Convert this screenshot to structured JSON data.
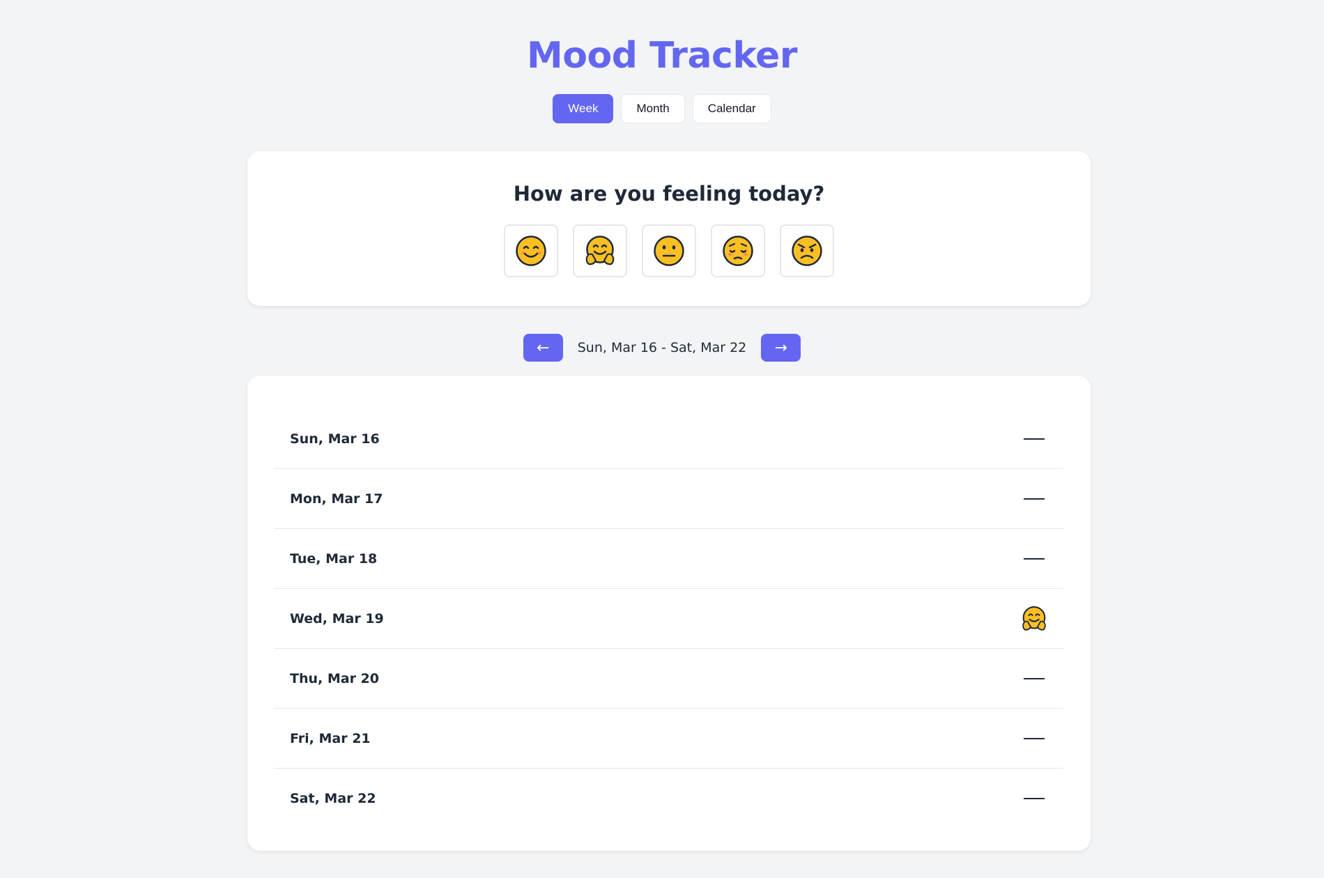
{
  "app": {
    "title": "Mood Tracker"
  },
  "tabs": [
    {
      "label": "Week",
      "active": true
    },
    {
      "label": "Month",
      "active": false
    },
    {
      "label": "Calendar",
      "active": false
    }
  ],
  "mood_prompt": "How are you feeling today?",
  "mood_options": [
    {
      "icon": "smiling-face-icon"
    },
    {
      "icon": "hugging-face-icon"
    },
    {
      "icon": "neutral-face-icon"
    },
    {
      "icon": "pensive-face-icon"
    },
    {
      "icon": "angry-face-icon"
    }
  ],
  "navigation": {
    "prev_label": "←",
    "next_label": "→",
    "range": "Sun, Mar 16 - Sat, Mar 22"
  },
  "days": [
    {
      "label": "Sun, Mar 16",
      "mood": null
    },
    {
      "label": "Mon, Mar 17",
      "mood": null
    },
    {
      "label": "Tue, Mar 18",
      "mood": null
    },
    {
      "label": "Wed, Mar 19",
      "mood": "hugging-face-icon"
    },
    {
      "label": "Thu, Mar 20",
      "mood": null
    },
    {
      "label": "Fri, Mar 21",
      "mood": null
    },
    {
      "label": "Sat, Mar 22",
      "mood": null
    }
  ],
  "colors": {
    "accent": "#6366f1",
    "background": "#f3f4f6",
    "card": "#ffffff",
    "emoji": "#fbbf24"
  }
}
